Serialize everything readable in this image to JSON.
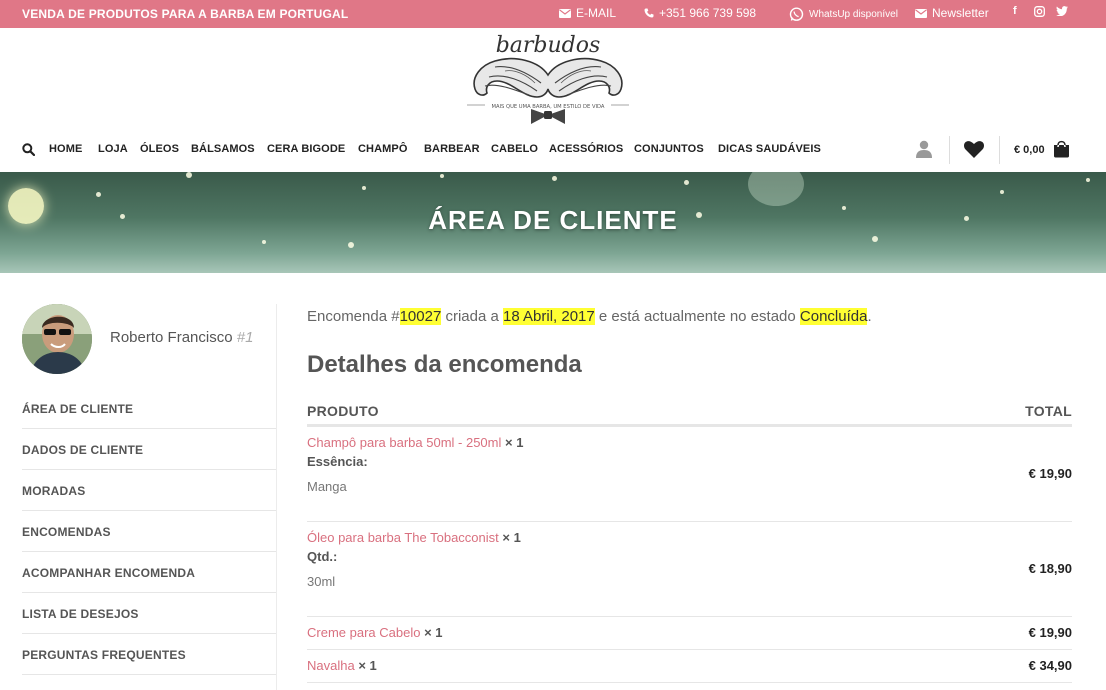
{
  "topbar": {
    "tagline": "VENDA DE PRODUTOS PARA A BARBA EM PORTUGAL",
    "email_label": "E-MAIL",
    "phone": "+351 966 739 598",
    "whatsapp": "WhatsUp disponível",
    "newsletter": "Newsletter",
    "social": [
      "f",
      "instagram",
      "twitter"
    ]
  },
  "logo": {
    "brand": "barbudos",
    "slogan": "MAIS QUE UMA BARBA, UM ESTILO DE VIDA"
  },
  "nav": {
    "items": [
      "HOME",
      "LOJA",
      "ÓLEOS",
      "BÁLSAMOS",
      "CERA BIGODE",
      "CHAMPÔ",
      "BARBEAR",
      "CABELO",
      "ACESSÓRIOS",
      "CONJUNTOS",
      "DICAS SAUDÁVEIS"
    ],
    "cart_amount": "€ 0,00"
  },
  "banner": {
    "title": "ÁREA DE CLIENTE"
  },
  "user": {
    "name": "Roberto Francisco",
    "id": "#1"
  },
  "sidebar": {
    "items": [
      "ÁREA DE CLIENTE",
      "DADOS DE CLIENTE",
      "MORADAS",
      "ENCOMENDAS",
      "ACOMPANHAR ENCOMENDA",
      "LISTA DE DESEJOS",
      "PERGUNTAS FREQUENTES"
    ]
  },
  "order": {
    "prefix": "Encomenda #",
    "number": "10027",
    "created": " criada a ",
    "date": "18 Abril, 2017",
    "status_text": " e está actualmente no estado ",
    "status": "Concluída",
    "suffix": "."
  },
  "details": {
    "title": "Detalhes da encomenda",
    "col_product": "PRODUTO",
    "col_total": "TOTAL",
    "rows": [
      {
        "name": "Champô para barba 50ml - 250ml",
        "qty": "× 1",
        "meta_key": "Essência:",
        "meta_val": "Manga",
        "price": "€ 19,90"
      },
      {
        "name": "Óleo para barba The Tobacconist",
        "qty": "× 1",
        "meta_key": "Qtd.:",
        "meta_val": "30ml",
        "price": "€ 18,90"
      },
      {
        "name": "Creme para Cabelo",
        "qty": "× 1",
        "price": "€ 19,90"
      },
      {
        "name": "Navalha",
        "qty": "× 1",
        "price": "€ 34,90"
      }
    ]
  },
  "colors": {
    "topbar": "#e07787",
    "link": "#d9707f",
    "highlight": "#ffff33"
  }
}
